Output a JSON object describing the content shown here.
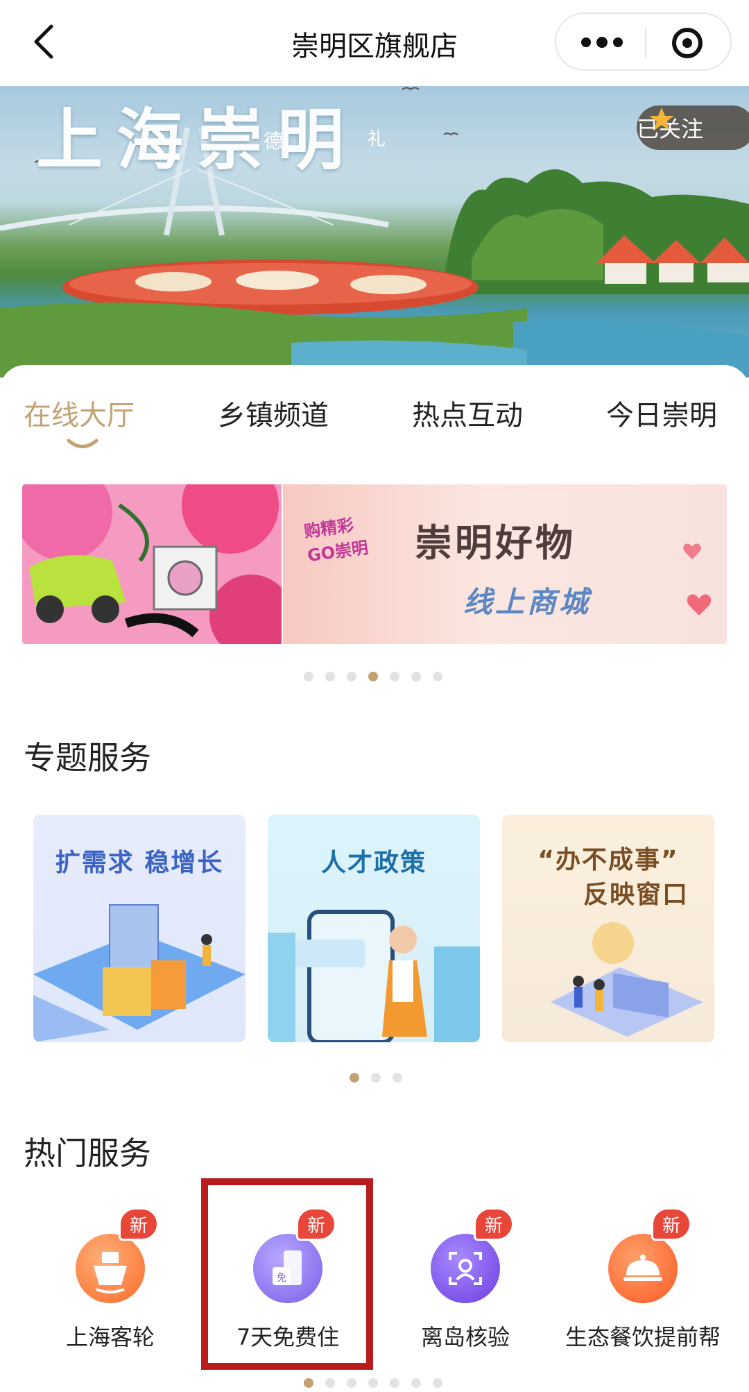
{
  "nav": {
    "title": "崇明区旗舰店",
    "back_icon": "chevron-left-icon",
    "more_icon": "more-dots-icon",
    "close_icon": "target-icon"
  },
  "hero": {
    "title": "上海崇明",
    "small_1": "德",
    "small_2": "礼",
    "follow_label": "已关注",
    "follow_icon": "star-icon"
  },
  "tabs": [
    {
      "label": "在线大厅",
      "active": true
    },
    {
      "label": "乡镇频道",
      "active": false
    },
    {
      "label": "热点互动",
      "active": false
    },
    {
      "label": "今日崇明",
      "active": false
    }
  ],
  "promo_banner": {
    "badge_line1": "购精彩",
    "badge_line2": "GO崇明",
    "title": "崇明好物",
    "subtitle": "线上商城",
    "pager_count": 7,
    "pager_active": 3
  },
  "topic_services": {
    "title": "专题服务",
    "cards": [
      {
        "caption": "扩需求 稳增长"
      },
      {
        "caption": "人才政策"
      },
      {
        "caption": "“办不成事”",
        "caption2": "反映窗口"
      }
    ],
    "pager_count": 3,
    "pager_active": 0
  },
  "hot_services": {
    "title": "热门服务",
    "items": [
      {
        "label": "上海客轮",
        "badge": "新",
        "icon": "ship-icon",
        "color": "#fb7a3c"
      },
      {
        "label": "7天免费住",
        "badge": "新",
        "icon": "hotel-free-icon",
        "color": "#8f6ff0"
      },
      {
        "label": "离岛核验",
        "badge": "新",
        "icon": "face-scan-icon",
        "color": "#7a4ae8"
      },
      {
        "label": "生态餐饮提前帮",
        "badge": "新",
        "icon": "dish-cover-icon",
        "color": "#fb6a34"
      }
    ]
  },
  "colors": {
    "accent": "#c2a271",
    "badge": "#e9463a",
    "highlight_box": "#b81c1c"
  }
}
